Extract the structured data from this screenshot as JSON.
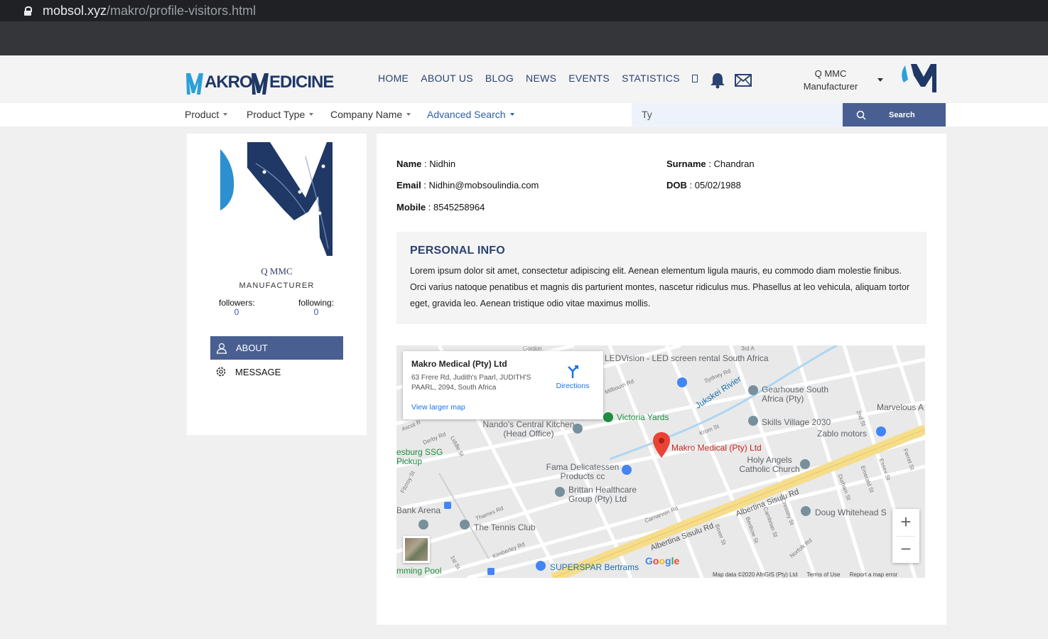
{
  "browser": {
    "url_host": "mobsol.xyz",
    "url_path": "/makro/profile-visitors.html"
  },
  "header": {
    "logo_text": "MAKRO MEDICINE",
    "nav": [
      "HOME",
      "ABOUT US",
      "BLOG",
      "NEWS",
      "EVENTS",
      "STATISTICS"
    ],
    "user_name": "Q MMC",
    "user_role": "Manufacturer",
    "bell_icon": "bell-icon",
    "mail_icon": "mail-icon"
  },
  "filters": {
    "product": "Product",
    "product_type": "Product Type",
    "company_name": "Company Name",
    "advanced_search": "Advanced Search",
    "search_value": "Ty",
    "search_button": "Search"
  },
  "profile": {
    "name": "Q MMC",
    "role": "MANUFACTURER",
    "followers_label": "followers:",
    "followers_count": "0",
    "following_label": "following:",
    "following_count": "0",
    "menu_about": "ABOUT",
    "menu_message": "MESSAGE"
  },
  "details": {
    "name_label": "Name",
    "name_value": "Nidhin",
    "surname_label": "Surname",
    "surname_value": "Chandran",
    "email_label": "Email",
    "email_value": "Nidhin@mobsoulindia.com",
    "dob_label": "DOB",
    "dob_value": "05/02/1988",
    "mobile_label": "Mobile",
    "mobile_value": "8545258964"
  },
  "personal_info": {
    "title": "PERSONAL INFO",
    "text": "Lorem ipsum dolor sit amet, consectetur adipiscing elit. Aenean elementum ligula mauris, eu commodo diam molestie finibus. Orci varius natoque penatibus et magnis dis parturient montes, nascetur ridiculus mus. Phasellus at leo vehicula, aliquam tortor eget, gravida leo. Aenean tristique odio vitae maximus mollis."
  },
  "map": {
    "place_title": "Makro Medical (Pty) Ltd",
    "address": "63 Frere Rd, Judith's Paarl, JUDITH'S PAARL, 2094, South Africa",
    "directions": "Directions",
    "view_larger": "View larger map",
    "marker_label": "Makro Medical (Pty) Ltd",
    "labels": {
      "ledvision": "LEDVision - LED screen rental South Africa",
      "gearhouse": "Gearhouse South Africa (Pty)",
      "marvelous": "Marvelous A",
      "victoria": "Victoria Yards",
      "jukskei": "Jukskei Rivier",
      "skills": "Skills Village 2030",
      "zablo": "Zablo motors",
      "nandos": "Nando's Central Kitchen (Head Office)",
      "ssg": "esburg SSG Pickup",
      "fama": "Fama Delicatessen Products cc",
      "holy": "Holy Angels Catholic Church",
      "brittan": "Brittan Healthcare Group (Pty) Ltd",
      "albertina1": "Albertina Sisulu Rd",
      "albertina2": "Albertina Sisulu Rd",
      "doug": "Doug Whitehead S",
      "bank": "Bank Arena",
      "tennis": "The Tennis Club",
      "pool": "mming Pool",
      "superspar": "SUPERSPAR Bertrams",
      "sydney": "Sydney Rd",
      "krom": "Krom St",
      "derby": "Derby Rd",
      "liddle": "Liddle St",
      "ascot": "Ascot R",
      "milbourn": "Milbourn Rd",
      "thames": "Thames Rd",
      "kimberley": "Kimberley Rd",
      "carnarvon": "Carnarvon Rd",
      "boxer": "Boxer St",
      "benbow": "Benbow St",
      "cambrian": "Cambrian St",
      "cressey": "Cressey St",
      "durham": "Durham St",
      "emerald": "Emerald St",
      "essex": "Essex St",
      "ferret": "Ferret St",
      "second": "2nd St",
      "norfolk": "Norfolk Rd",
      "first": "1st St",
      "fitzroy": "Fitzroy St",
      "gordon": "Gordon",
      "third": "3rd A"
    },
    "google": "Google",
    "attribution": [
      "Map data ©2020 AfriGIS (Pty) Ltd",
      "Terms of Use",
      "Report a map error"
    ],
    "zoom_in": "+",
    "zoom_out": "−"
  }
}
